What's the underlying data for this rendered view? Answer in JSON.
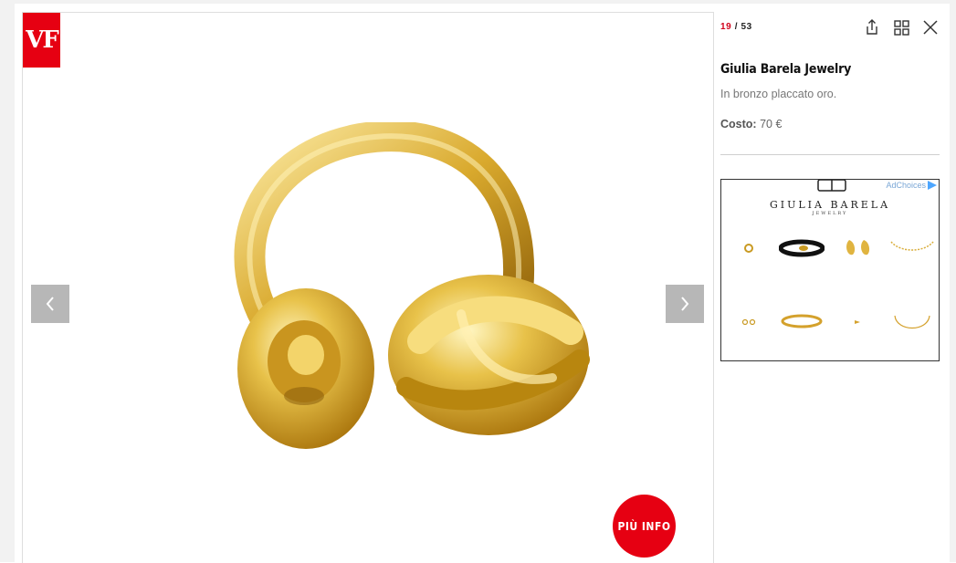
{
  "brand": {
    "logo_text": "VF",
    "accent_color": "#e60012"
  },
  "gallery": {
    "current": "19",
    "separator": "/",
    "total": "53"
  },
  "toolbar": {
    "icons": [
      "share-icon",
      "grid-icon",
      "close-icon"
    ]
  },
  "viewer": {
    "prev_icon": "chevron-left-icon",
    "next_icon": "chevron-right-icon",
    "more_info_label": "PIÙ INFO"
  },
  "item": {
    "title": "Giulia Barela Jewelry",
    "description": "In bronzo placcato oro.",
    "cost_label": "Costo:",
    "cost_value": "70 €"
  },
  "ad": {
    "adchoices_label": "AdChoices",
    "brand_name": "GIULIA BARELA",
    "brand_sub": "JEWELRY"
  }
}
